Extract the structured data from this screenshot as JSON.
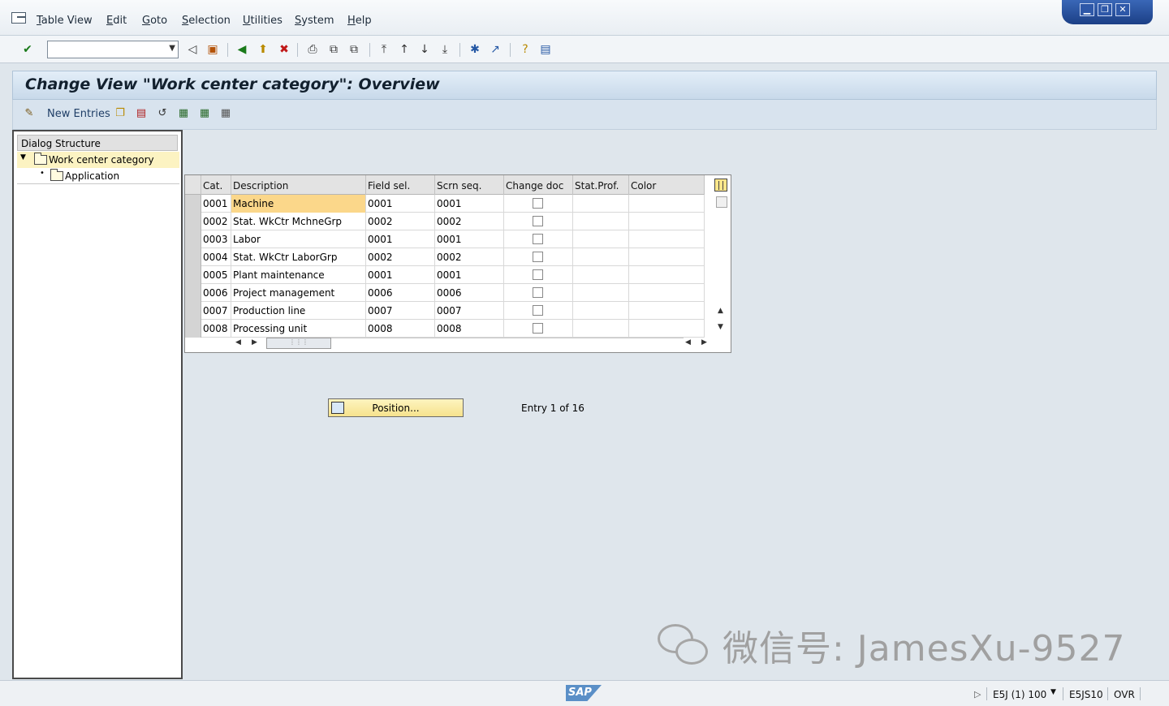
{
  "menubar": {
    "items": [
      "Table View",
      "Edit",
      "Goto",
      "Selection",
      "Utilities",
      "System",
      "Help"
    ]
  },
  "toolbar": {
    "command_field_value": ""
  },
  "title": "Change View \"Work center category\": Overview",
  "app_toolbar": {
    "new_entries_label": "New Entries"
  },
  "dialog_structure": {
    "header": "Dialog Structure",
    "items": [
      {
        "label": "Work center category",
        "selected": true
      },
      {
        "label": "Application",
        "selected": false
      }
    ]
  },
  "table": {
    "columns": [
      "Cat.",
      "Description",
      "Field sel.",
      "Scrn seq.",
      "Change doc",
      "Stat.Prof.",
      "Color"
    ],
    "rows": [
      {
        "cat": "0001",
        "description": "Machine",
        "field_sel": "0001",
        "scrn_seq": "0001",
        "change_doc": false,
        "stat_prof": "",
        "color": ""
      },
      {
        "cat": "0002",
        "description": "Stat. WkCtr MchneGrp",
        "field_sel": "0002",
        "scrn_seq": "0002",
        "change_doc": false,
        "stat_prof": "",
        "color": ""
      },
      {
        "cat": "0003",
        "description": "Labor",
        "field_sel": "0001",
        "scrn_seq": "0001",
        "change_doc": false,
        "stat_prof": "",
        "color": ""
      },
      {
        "cat": "0004",
        "description": "Stat. WkCtr LaborGrp",
        "field_sel": "0002",
        "scrn_seq": "0002",
        "change_doc": false,
        "stat_prof": "",
        "color": ""
      },
      {
        "cat": "0005",
        "description": "Plant maintenance",
        "field_sel": "0001",
        "scrn_seq": "0001",
        "change_doc": false,
        "stat_prof": "",
        "color": ""
      },
      {
        "cat": "0006",
        "description": "Project management",
        "field_sel": "0006",
        "scrn_seq": "0006",
        "change_doc": false,
        "stat_prof": "",
        "color": ""
      },
      {
        "cat": "0007",
        "description": "Production line",
        "field_sel": "0007",
        "scrn_seq": "0007",
        "change_doc": false,
        "stat_prof": "",
        "color": ""
      },
      {
        "cat": "0008",
        "description": "Processing unit",
        "field_sel": "0008",
        "scrn_seq": "0008",
        "change_doc": false,
        "stat_prof": "",
        "color": ""
      }
    ]
  },
  "position_button_label": "Position...",
  "entry_info": "Entry 1 of 16",
  "watermark": "微信号: JamesXu-9527",
  "statusbar": {
    "logo": "SAP",
    "system": "E5J (1) 100",
    "server": "E5JS10",
    "mode": "OVR"
  },
  "colors": {
    "selected_cell": "#fbd78a",
    "title_bg": "#c8d9ea",
    "window_controls": "#1c3f86"
  }
}
